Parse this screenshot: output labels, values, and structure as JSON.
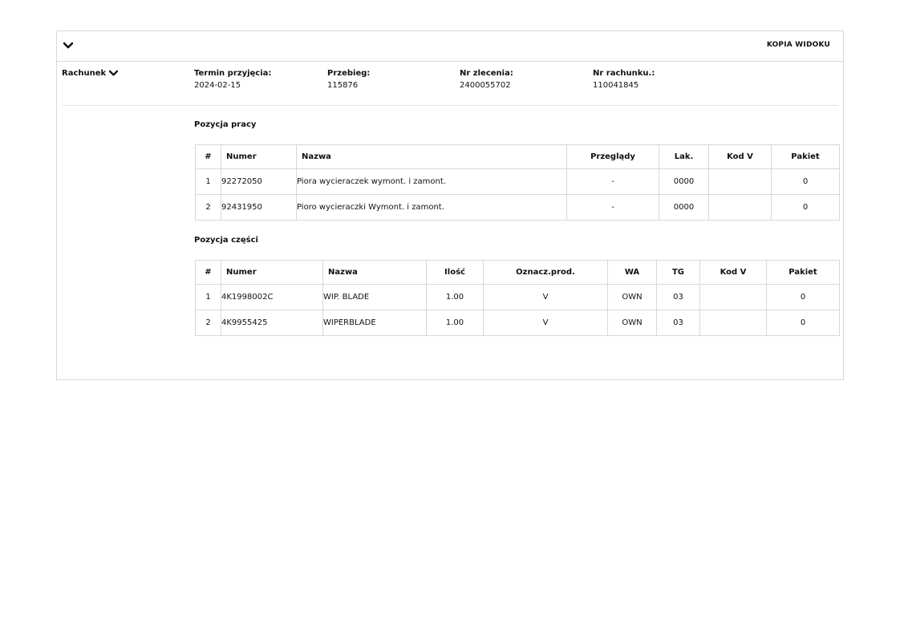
{
  "header": {
    "kopia_label": "KOPIA WIDOKU"
  },
  "section": {
    "label": "Rachunek"
  },
  "meta": [
    {
      "label": "Termin przyjęcia:",
      "value": "2024-02-15"
    },
    {
      "label": "Przebieg:",
      "value": "115876"
    },
    {
      "label": "Nr zlecenia:",
      "value": "2400055702"
    },
    {
      "label": "Nr rachunku.:",
      "value": "110041845"
    }
  ],
  "work": {
    "title": "Pozycja pracy",
    "headers": [
      "#",
      "Numer",
      "Nazwa",
      "Przeglądy",
      "Lak.",
      "Kod V",
      "Pakiet"
    ],
    "rows": [
      [
        "1",
        "92272050",
        "Piora wycieraczek wymont. i zamont.",
        "-",
        "0000",
        "",
        "0"
      ],
      [
        "2",
        "92431950",
        "Pioro wycieraczki Wymont. i zamont.",
        "-",
        "0000",
        "",
        "0"
      ]
    ]
  },
  "parts": {
    "title": "Pozycja części",
    "headers": [
      "#",
      "Numer",
      "Nazwa",
      "Ilość",
      "Oznacz.prod.",
      "WA",
      "TG",
      "Kod V",
      "Pakiet"
    ],
    "rows": [
      [
        "1",
        "4K1998002C",
        "WIP. BLADE",
        "1.00",
        "V",
        "OWN",
        "03",
        "",
        "0"
      ],
      [
        "2",
        "4K9955425",
        "WIPERBLADE",
        "1.00",
        "V",
        "OWN",
        "03",
        "",
        "0"
      ]
    ]
  },
  "icons": {
    "collapse": "chevron-down-icon"
  }
}
